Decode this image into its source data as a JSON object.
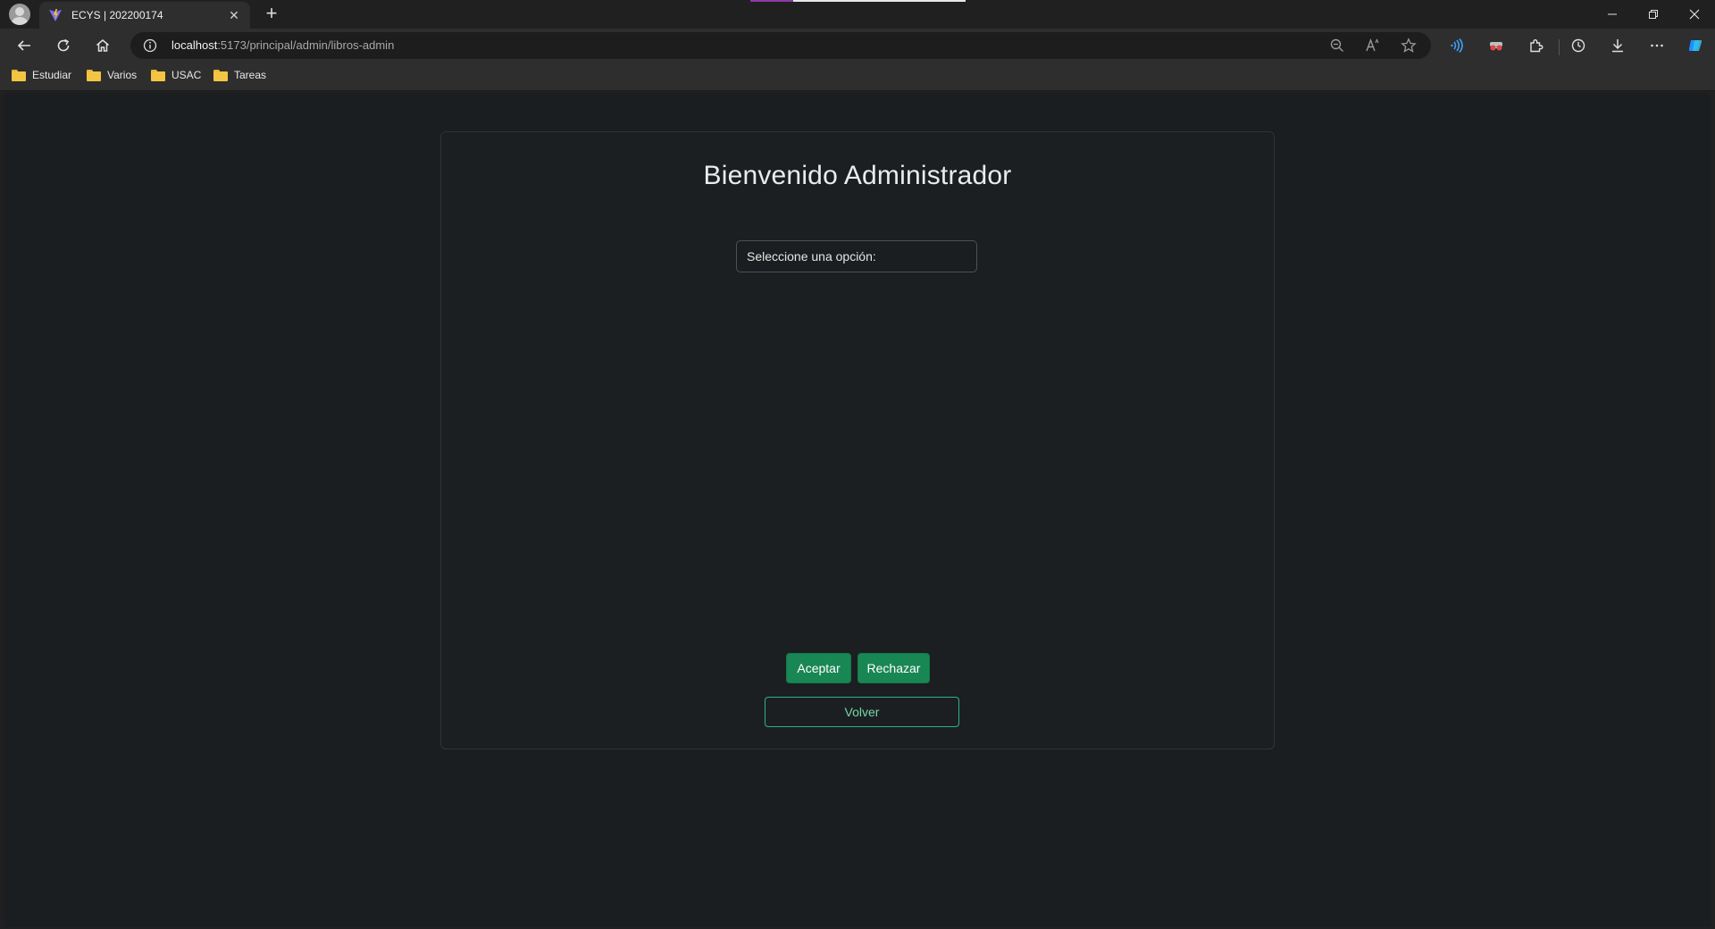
{
  "browser": {
    "tab": {
      "title": "ECYS | 202200174"
    },
    "address": {
      "host": "localhost",
      "rest": ":5173/principal/admin/libros-admin"
    },
    "bookmarks": [
      "Estudiar",
      "Varios",
      "USAC",
      "Tareas"
    ]
  },
  "page": {
    "title": "Bienvenido Administrador",
    "select": {
      "selected": "Seleccione una opción:"
    },
    "buttons": {
      "accept": "Aceptar",
      "reject": "Rechazar",
      "back": "Volver"
    }
  },
  "colors": {
    "page_bg": "#1b1e20",
    "success": "#198754",
    "outline_success": "#2fb380"
  }
}
